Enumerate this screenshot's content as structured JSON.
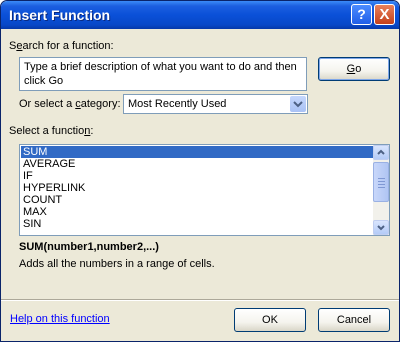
{
  "window": {
    "title": "Insert Function"
  },
  "titlebar": {
    "help_label": "?",
    "close_label": "X"
  },
  "search": {
    "label_pre": "S",
    "label_ul": "e",
    "label_post": "arch for a function:",
    "text_line1": "Type a brief description of what you want to do and then",
    "text_line2": "click Go",
    "go_ul": "G",
    "go_post": "o"
  },
  "category": {
    "label_pre": "Or select a ",
    "label_ul": "c",
    "label_post": "ategory:",
    "selected": "Most Recently Used"
  },
  "functions": {
    "label_pre": "Select a functio",
    "label_ul": "n",
    "label_post": ":",
    "items": [
      "SUM",
      "AVERAGE",
      "IF",
      "HYPERLINK",
      "COUNT",
      "MAX",
      "SIN"
    ],
    "selected_index": 0
  },
  "details": {
    "signature": "SUM(number1,number2,...)",
    "description": "Adds all the numbers in a range of cells."
  },
  "footer": {
    "help_link": "Help on this function",
    "ok_label": "OK",
    "cancel_label": "Cancel"
  }
}
